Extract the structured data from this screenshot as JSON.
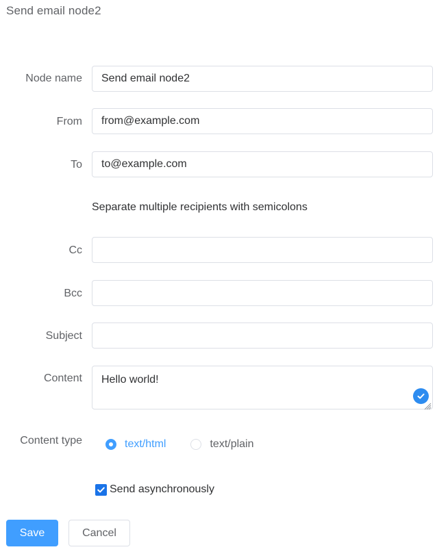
{
  "page": {
    "title": "Send email node2"
  },
  "form": {
    "node_name": {
      "label": "Node name",
      "value": "Send email node2"
    },
    "from": {
      "label": "From",
      "value": "from@example.com"
    },
    "to": {
      "label": "To",
      "value": "to@example.com"
    },
    "recipients_hint": "Separate multiple recipients with semicolons",
    "cc": {
      "label": "Cc",
      "value": ""
    },
    "bcc": {
      "label": "Bcc",
      "value": ""
    },
    "subject": {
      "label": "Subject",
      "value": ""
    },
    "content": {
      "label": "Content",
      "value": "Hello world!"
    },
    "content_type": {
      "label": "Content type",
      "options": [
        {
          "label": "text/html",
          "checked": true
        },
        {
          "label": "text/plain",
          "checked": false
        }
      ]
    },
    "send_async": {
      "label": "Send asynchronously",
      "checked": true
    }
  },
  "actions": {
    "save_label": "Save",
    "cancel_label": "Cancel"
  },
  "colors": {
    "primary": "#409eff",
    "checkbox": "#1a73e8",
    "badge": "#2d8cf0",
    "border": "#dcdfe6",
    "label_text": "#606266"
  }
}
